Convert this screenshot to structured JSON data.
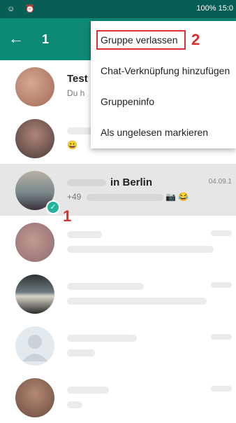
{
  "status": {
    "left_icons": "☺ ⏰",
    "right_text": "100% 15:0"
  },
  "app_bar": {
    "back_icon": "←",
    "selected_count": "1"
  },
  "menu": {
    "items": [
      {
        "label": "Gruppe verlassen"
      },
      {
        "label": "Chat-Verknüpfung hinzufügen"
      },
      {
        "label": "Gruppeninfo"
      },
      {
        "label": "Als ungelesen markieren"
      }
    ]
  },
  "chats": [
    {
      "name": "Test",
      "subtitle": "Du h"
    },
    {
      "name": "",
      "subtitle": "😀"
    },
    {
      "name": "in Berlin",
      "time": "04.09.1",
      "subtitle": "+49",
      "subtitle_icons": "📷 😂"
    },
    {
      "name": "",
      "subtitle": ""
    },
    {
      "name": "",
      "subtitle": ""
    },
    {
      "name": "",
      "subtitle": ""
    },
    {
      "name": "",
      "subtitle": ""
    }
  ],
  "annotations": {
    "first": "1",
    "second": "2"
  },
  "colors": {
    "status_bar": "#075e54",
    "app_bar": "#0d8a76",
    "annotation": "#d93030",
    "check": "#25b39e"
  }
}
